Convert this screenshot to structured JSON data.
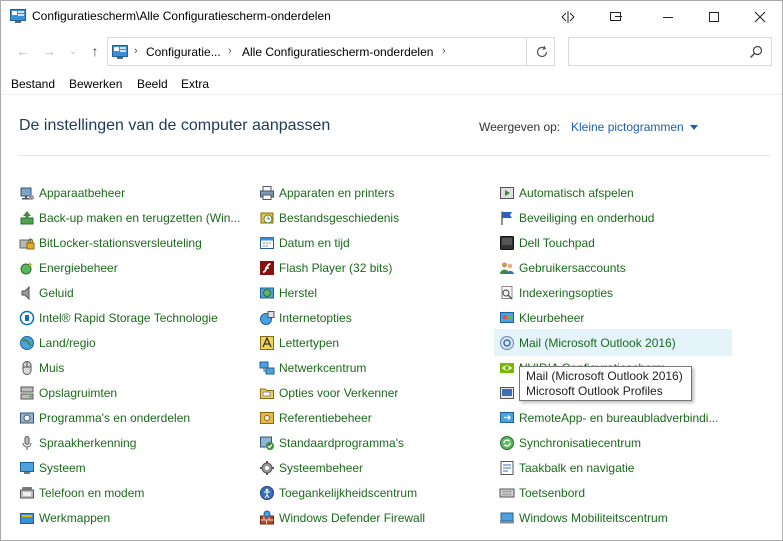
{
  "window": {
    "title": "Configuratiescherm\\Alle Configuratiescherm-onderdelen"
  },
  "address": {
    "crumbs": [
      "Configuratie...",
      "Alle Configuratiescherm-onderdelen"
    ],
    "search_placeholder": ""
  },
  "menu": [
    "Bestand",
    "Bewerken",
    "Beeld",
    "Extra"
  ],
  "header": {
    "title": "De instellingen van de computer aanpassen",
    "view_label": "Weergeven op:",
    "view_value": "Kleine pictogrammen"
  },
  "columns": [
    [
      {
        "label": "Apparaatbeheer",
        "icon": "device-manager-icon"
      },
      {
        "label": "Back-up maken en terugzetten (Win...",
        "icon": "backup-icon"
      },
      {
        "label": "BitLocker-stationsversleuteling",
        "icon": "bitlocker-icon"
      },
      {
        "label": "Energiebeheer",
        "icon": "power-icon"
      },
      {
        "label": "Geluid",
        "icon": "speaker-icon"
      },
      {
        "label": "Intel® Rapid Storage Technologie",
        "icon": "intel-icon"
      },
      {
        "label": "Land/regio",
        "icon": "globe-icon"
      },
      {
        "label": "Muis",
        "icon": "mouse-icon"
      },
      {
        "label": "Opslagruimten",
        "icon": "storage-icon"
      },
      {
        "label": "Programma's en onderdelen",
        "icon": "programs-icon"
      },
      {
        "label": "Spraakherkenning",
        "icon": "microphone-icon"
      },
      {
        "label": "Systeem",
        "icon": "monitor-icon"
      },
      {
        "label": "Telefoon en modem",
        "icon": "phone-icon"
      },
      {
        "label": "Werkmappen",
        "icon": "work-folders-icon"
      }
    ],
    [
      {
        "label": "Apparaten en printers",
        "icon": "printer-icon"
      },
      {
        "label": "Bestandsgeschiedenis",
        "icon": "file-history-icon"
      },
      {
        "label": "Datum en tijd",
        "icon": "calendar-clock-icon"
      },
      {
        "label": "Flash Player (32 bits)",
        "icon": "flash-icon"
      },
      {
        "label": "Herstel",
        "icon": "recovery-icon"
      },
      {
        "label": "Internetopties",
        "icon": "internet-options-icon"
      },
      {
        "label": "Lettertypen",
        "icon": "fonts-icon"
      },
      {
        "label": "Netwerkcentrum",
        "icon": "network-icon"
      },
      {
        "label": "Opties voor Verkenner",
        "icon": "folder-options-icon"
      },
      {
        "label": "Referentiebeheer",
        "icon": "credential-icon"
      },
      {
        "label": "Standaardprogramma's",
        "icon": "default-programs-icon"
      },
      {
        "label": "Systeembeheer",
        "icon": "admin-tools-icon"
      },
      {
        "label": "Toegankelijkheidscentrum",
        "icon": "accessibility-icon"
      },
      {
        "label": "Windows Defender Firewall",
        "icon": "firewall-icon"
      }
    ],
    [
      {
        "label": "Automatisch afspelen",
        "icon": "autoplay-icon"
      },
      {
        "label": "Beveiliging en onderhoud",
        "icon": "flag-icon"
      },
      {
        "label": "Dell Touchpad",
        "icon": "touchpad-icon"
      },
      {
        "label": "Gebruikersaccounts",
        "icon": "users-icon"
      },
      {
        "label": "Indexeringsopties",
        "icon": "indexing-icon"
      },
      {
        "label": "Kleurbeheer",
        "icon": "color-icon"
      },
      {
        "label": "Mail (Microsoft Outlook 2016)",
        "icon": "mail-icon"
      },
      {
        "label": "NVIDIA Configuratiescherm",
        "icon": "nvidia-icon"
      },
      {
        "label": "",
        "icon": "realtek-icon"
      },
      {
        "label": "RemoteApp- en bureaubladverbindi...",
        "icon": "remoteapp-icon"
      },
      {
        "label": "Synchronisatiecentrum",
        "icon": "sync-icon"
      },
      {
        "label": "Taakbalk en navigatie",
        "icon": "taskbar-icon"
      },
      {
        "label": "Toetsenbord",
        "icon": "keyboard-icon"
      },
      {
        "label": "Windows Mobiliteitscentrum",
        "icon": "mobility-icon"
      }
    ]
  ],
  "tooltip": {
    "line1": "Mail (Microsoft Outlook 2016)",
    "line2": "Microsoft Outlook Profiles"
  },
  "colors": {
    "link": "#1a6b1a",
    "title": "#1e395b",
    "accent": "#1a5fb4",
    "hover": "#e5f3fb"
  }
}
